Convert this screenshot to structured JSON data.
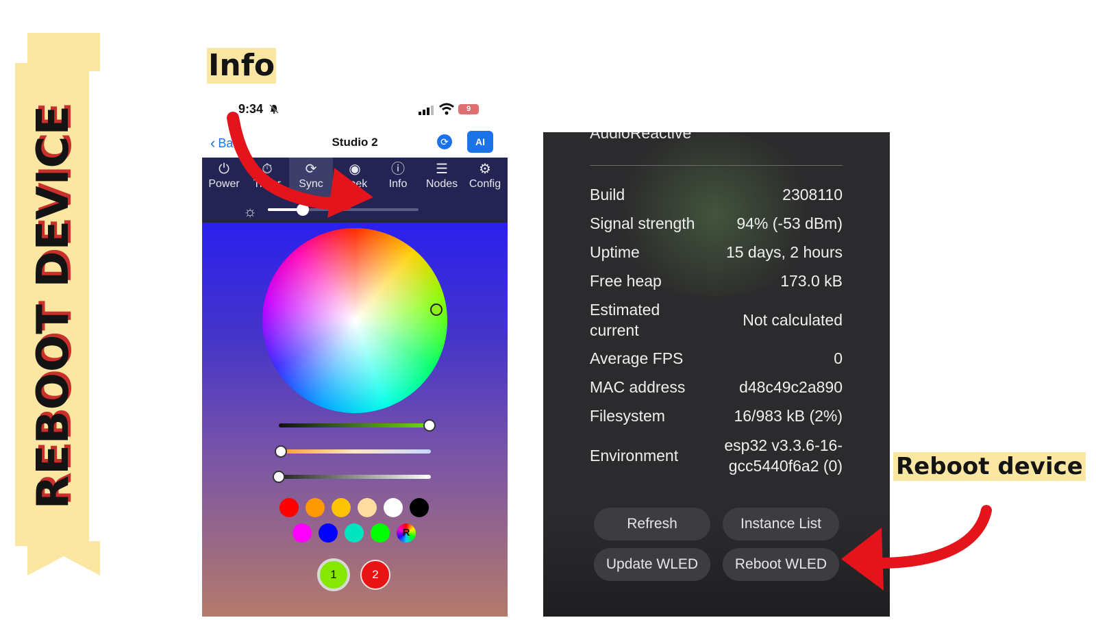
{
  "banner": {
    "text": "REBOOT DEVICE"
  },
  "headings": {
    "info": "Info",
    "reboot": "Reboot device"
  },
  "phone": {
    "status": {
      "time": "9:34",
      "battery": "9"
    },
    "nav": {
      "back_label": "Back",
      "title": "Studio 2",
      "ai_label": "AI"
    },
    "toolbar": [
      {
        "label": "Power",
        "icon": "power-icon"
      },
      {
        "label": "Timer",
        "icon": "timer-icon"
      },
      {
        "label": "Sync",
        "icon": "sync-icon"
      },
      {
        "label": "Peek",
        "icon": "peek-icon"
      },
      {
        "label": "Info",
        "icon": "info-icon"
      },
      {
        "label": "Nodes",
        "icon": "nodes-icon"
      },
      {
        "label": "Config",
        "icon": "gear-icon"
      }
    ],
    "swatches_row1": [
      "#ff0000",
      "#ff9900",
      "#ffc400",
      "#ffdca0",
      "#ffffff",
      "#000000"
    ],
    "swatches_row2": [
      "#ff00ff",
      "#0000ff",
      "#00e5c0",
      "#00ff00"
    ],
    "random_label": "R",
    "presets": [
      "1",
      "2"
    ]
  },
  "info_panel": {
    "section_label": "AudioReactive",
    "rows": [
      {
        "label": "Build",
        "value": "2308110"
      },
      {
        "label": "Signal strength",
        "value": "94% (-53 dBm)"
      },
      {
        "label": "Uptime",
        "value": "15 days, 2 hours"
      },
      {
        "label": "Free heap",
        "value": "173.0 kB"
      },
      {
        "label": "Estimated current",
        "value": "Not calculated"
      },
      {
        "label": "Average FPS",
        "value": "0"
      },
      {
        "label": "MAC address",
        "value": "d48c49c2a890"
      },
      {
        "label": "Filesystem",
        "value": "16/983 kB (2%)"
      },
      {
        "label": "Environment",
        "value": "esp32 v3.3.6-16-gcc5440f6a2 (0)"
      }
    ],
    "buttons": {
      "refresh": "Refresh",
      "instance_list": "Instance List",
      "update": "Update WLED",
      "reboot": "Reboot WLED"
    }
  },
  "colors": {
    "accent": "#1a73e8",
    "arrow": "#e3141b",
    "highlight": "#fbe7a1",
    "toolbar_bg": "#232454"
  }
}
